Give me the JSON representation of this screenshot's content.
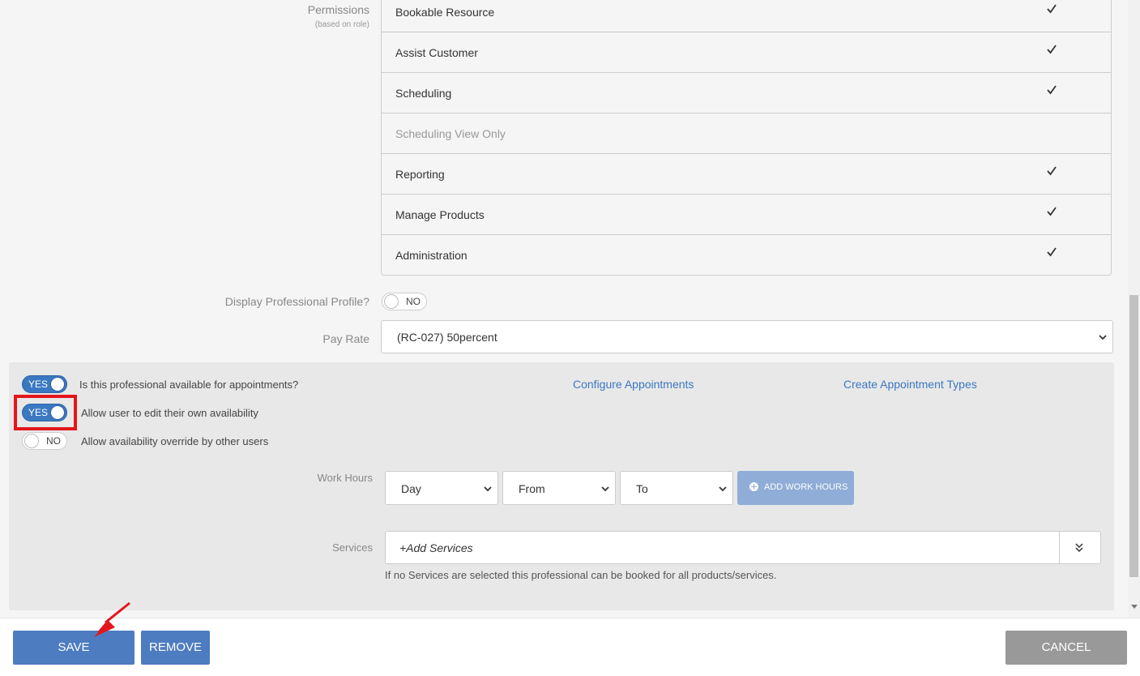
{
  "permissions": {
    "label": "Permissions",
    "sublabel": "(based on role)",
    "items": [
      {
        "name": "Bookable Resource",
        "checked": true,
        "disabled": false
      },
      {
        "name": "Assist Customer",
        "checked": true,
        "disabled": false
      },
      {
        "name": "Scheduling",
        "checked": true,
        "disabled": false
      },
      {
        "name": "Scheduling View Only",
        "checked": false,
        "disabled": true
      },
      {
        "name": "Reporting",
        "checked": true,
        "disabled": false
      },
      {
        "name": "Manage Products",
        "checked": true,
        "disabled": false
      },
      {
        "name": "Administration",
        "checked": true,
        "disabled": false
      }
    ]
  },
  "display_profile": {
    "label": "Display Professional Profile?",
    "toggle": "NO"
  },
  "pay_rate": {
    "label": "Pay Rate",
    "value": "(RC-027) 50percent"
  },
  "availability": {
    "available_toggle": "YES",
    "available_text": "Is this professional available for appointments?",
    "edit_toggle": "YES",
    "edit_text": "Allow user to edit their own availability",
    "override_toggle": "NO",
    "override_text": "Allow availability override by other users",
    "configure_link": "Configure Appointments",
    "create_link": "Create Appointment Types"
  },
  "work_hours": {
    "label": "Work Hours",
    "day": "Day",
    "from": "From",
    "to": "To",
    "add_button": "ADD WORK HOURS"
  },
  "services": {
    "label": "Services",
    "placeholder": "+Add Services",
    "hint": "If no Services are selected this professional can be booked for all products/services."
  },
  "footer": {
    "save": "SAVE",
    "remove": "REMOVE",
    "cancel": "CANCEL"
  },
  "colors": {
    "accent": "#3a78c2",
    "button": "#4d7cc0",
    "highlight": "#e3161b",
    "cancel": "#999999"
  }
}
